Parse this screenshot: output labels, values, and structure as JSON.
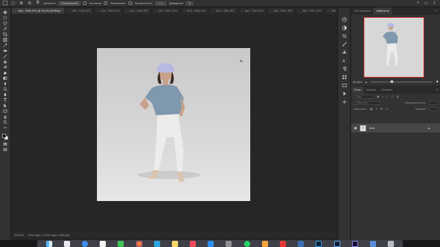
{
  "option_bar": {
    "items": [
      {
        "label": "Заплатка:",
        "value": "Нормальный"
      },
      {
        "label": "Источник"
      },
      {
        "label": "Назначение"
      },
      {
        "label": "Прозрачность"
      },
      {
        "label": "Узор"
      },
      {
        "label": "Диффузия:",
        "value": "5"
      }
    ]
  },
  "tabs": [
    {
      "label": "IMG_7983.JPG @ 33,3% (RGB/8) *",
      "active": true
    },
    {
      "label": "IMG_7984.JPG"
    },
    {
      "label": "IMG_7985.JPG"
    },
    {
      "label": "IMG_7986.JPG"
    },
    {
      "label": "IMG_7987.JPG"
    },
    {
      "label": "IMG_7988.JPG"
    },
    {
      "label": "IMG_7989.JPG"
    },
    {
      "label": "IMG_7990.JPG"
    },
    {
      "label": "IMG_7991.JPG"
    },
    {
      "label": "IMG_7992.JPG"
    },
    {
      "label": "IMG_7"
    }
  ],
  "status": {
    "zoom": "33,33%",
    "dimensions": "3744 пикс. X 3744 пикс. (300 ppi)"
  },
  "navigator": {
    "tabs": [
      {
        "label": "Гистограмма"
      },
      {
        "label": "Навигатор",
        "active": true
      }
    ],
    "zoom": "33,33%",
    "zoom_level": 0.33
  },
  "layers": {
    "tabs": [
      {
        "label": "Слои",
        "active": true
      },
      {
        "label": "Каналы"
      },
      {
        "label": "Контуры"
      }
    ],
    "search_placeholder": "Вид",
    "blend_mode": "Обычные",
    "opacity_label": "Непрозрачность:",
    "lock_label": "Закрепить:",
    "fill_label": "Заливка:",
    "layer_name": "Фон"
  },
  "colors": {
    "accent_red": "#e03030",
    "top_color": "#7f98ad",
    "hat_color": "#b7b8e4",
    "pants_color": "#ececea"
  }
}
